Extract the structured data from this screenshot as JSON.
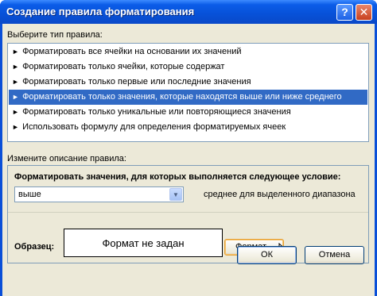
{
  "window": {
    "title": "Создание правила форматирования",
    "help_symbol": "?",
    "close_symbol": "✕"
  },
  "rule_type": {
    "label": "Выберите тип правила:",
    "items": [
      {
        "label": "Форматировать все ячейки на основании их значений",
        "selected": false
      },
      {
        "label": "Форматировать только ячейки, которые содержат",
        "selected": false
      },
      {
        "label": "Форматировать только первые или последние значения",
        "selected": false
      },
      {
        "label": "Форматировать только значения, которые находятся выше или ниже среднего",
        "selected": true
      },
      {
        "label": "Форматировать только уникальные или повторяющиеся значения",
        "selected": false
      },
      {
        "label": "Использовать формулу для определения форматируемых ячеек",
        "selected": false
      }
    ],
    "arrow_symbol": "►"
  },
  "description": {
    "label": "Измените описание правила:",
    "condition_title": "Форматировать значения, для которых выполняется следующее условие:",
    "combo_value": "выше",
    "combo_suffix": "среднее для выделенного диапазона",
    "sample_label": "Образец:",
    "sample_text": "Формат не задан",
    "format_button": "Формат..."
  },
  "footer": {
    "ok_button": "ОК",
    "cancel_button": "Отмена"
  },
  "colors": {
    "selection": "#316ac5",
    "titlebar": "#0751d8",
    "dialog_bg": "#ece9d8"
  }
}
